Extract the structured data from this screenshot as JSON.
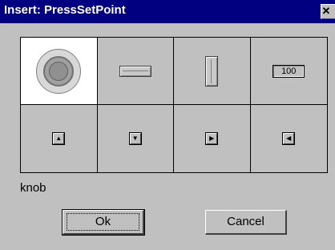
{
  "window": {
    "title": "Insert: PressSetPoint",
    "close_glyph": "✕"
  },
  "palette": {
    "selected_index": 0,
    "items": [
      {
        "kind": "knob",
        "icon": "knob-icon"
      },
      {
        "kind": "horizontal-slider",
        "icon": "horizontal-bar-icon"
      },
      {
        "kind": "vertical-slider",
        "icon": "vertical-bar-icon"
      },
      {
        "kind": "numeric-display",
        "icon": "numeric-display-icon",
        "text": "100"
      },
      {
        "kind": "up-button",
        "icon": "arrow-up-icon",
        "glyph": "▲"
      },
      {
        "kind": "down-button",
        "icon": "arrow-down-icon",
        "glyph": "▼"
      },
      {
        "kind": "right-button",
        "icon": "arrow-right-icon",
        "glyph": "▶"
      },
      {
        "kind": "left-button",
        "icon": "arrow-left-icon",
        "glyph": "◀"
      }
    ]
  },
  "status": {
    "selected_label": "knob"
  },
  "buttons": {
    "ok_label": "Ok",
    "cancel_label": "Cancel"
  },
  "colors": {
    "titlebar": "#000080",
    "face": "#c0c0c0",
    "selected_cell": "#ffffff"
  }
}
